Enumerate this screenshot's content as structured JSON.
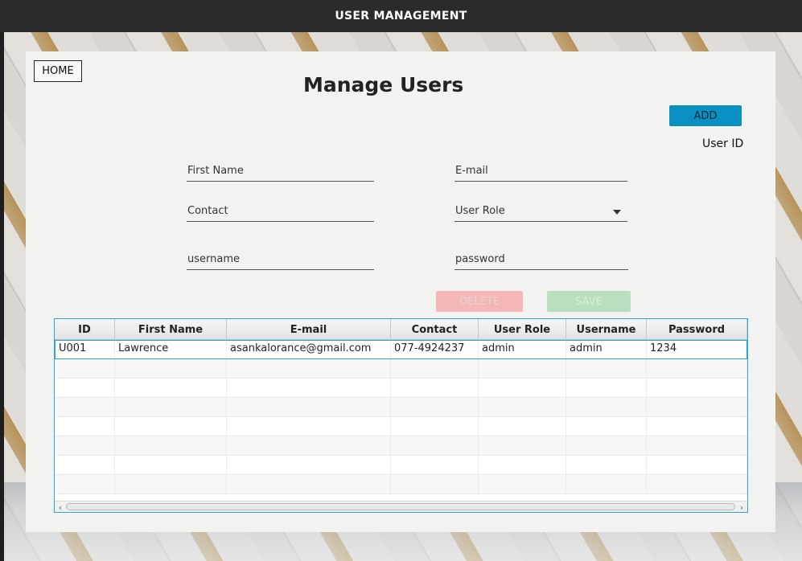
{
  "window": {
    "title": "USER MANAGEMENT"
  },
  "nav": {
    "home_label": "HOME"
  },
  "page": {
    "title": "Manage Users"
  },
  "actions": {
    "add_label": "ADD",
    "delete_label": "DELETE",
    "save_label": "SAVE"
  },
  "user_id_label": "User ID",
  "form": {
    "first_name": {
      "placeholder": "First Name",
      "value": ""
    },
    "email": {
      "placeholder": "E-mail",
      "value": ""
    },
    "contact": {
      "placeholder": "Contact",
      "value": ""
    },
    "user_role": {
      "placeholder": "User Role",
      "value": ""
    },
    "username": {
      "placeholder": "username",
      "value": ""
    },
    "password": {
      "placeholder": "password",
      "value": ""
    }
  },
  "table": {
    "columns": [
      "ID",
      "First Name",
      "E-mail",
      "Contact",
      "User Role",
      "Username",
      "Password"
    ],
    "rows": [
      [
        "U001",
        "Lawrence",
        "asankalorance@gmail.com",
        "077-4924237",
        "admin",
        "admin",
        "1234"
      ]
    ]
  },
  "colors": {
    "add_button": "#0a8fc2",
    "delete_button": "#f4b7b7",
    "save_button": "#b9e0be",
    "table_border": "#29a8d8"
  },
  "icons": [
    "dropdown-arrow-icon",
    "scroll-left-icon",
    "scroll-right-icon"
  ]
}
